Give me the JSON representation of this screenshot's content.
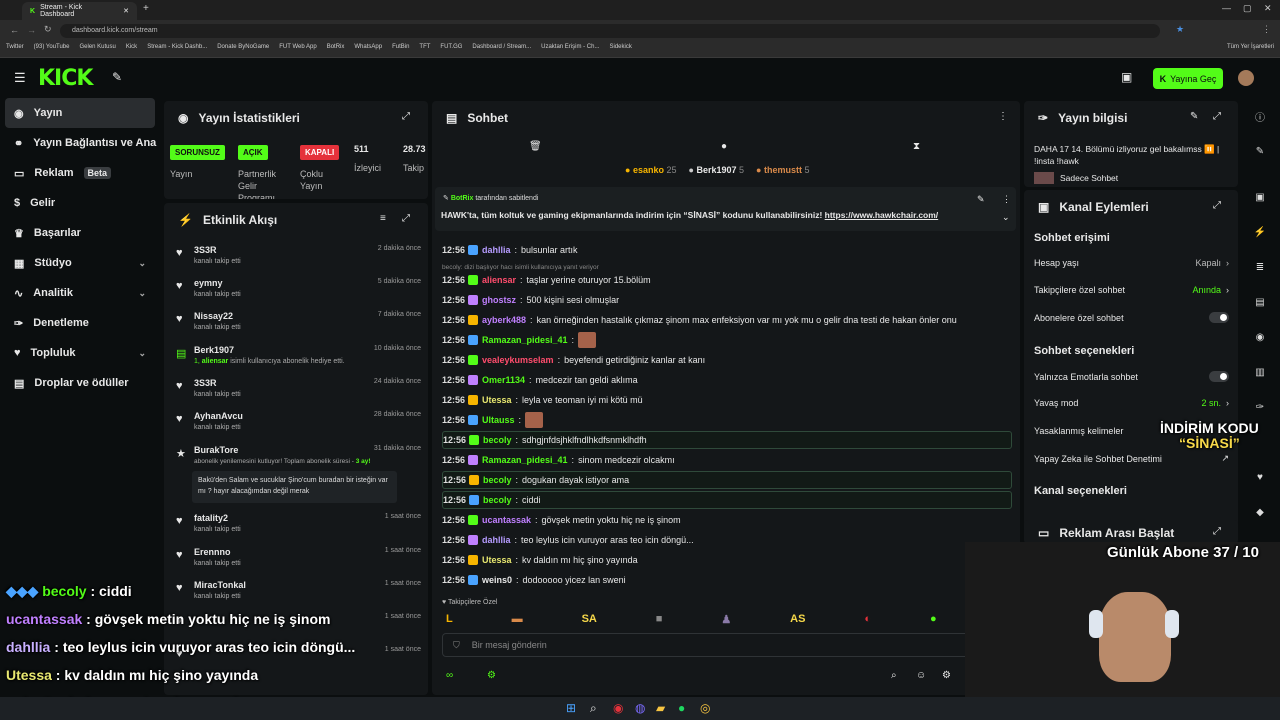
{
  "browser": {
    "tabs": [
      {
        "label": "Stream - Kick Dashboard",
        "active": true
      }
    ],
    "url": "dashboard.kick.com/stream",
    "bookmarks": [
      "Twitter",
      "(93) YouTube",
      "Gelen Kutusu",
      "Kick",
      "Stream - Kick Dashb...",
      "Donate ByNoGame",
      "FUT Web App",
      "BotRix",
      "WhatsApp",
      "FutBin",
      "TFT",
      "FUT.GG",
      "Dashboard / Stream...",
      "Uzaktan Erişim - Ch...",
      "Sidekick"
    ],
    "all_bookmarks": "Tüm Yer İşaretleri"
  },
  "header": {
    "logo": "KICK",
    "go_live": "Yayına Geç"
  },
  "sidebar": {
    "items": [
      {
        "label": "Yayın",
        "icon": "radio-icon",
        "active": true
      },
      {
        "label": "Yayın Bağlantısı ve Anahtarı",
        "icon": "link-icon"
      },
      {
        "label": "Reklam",
        "icon": "ad-icon",
        "badge": "Beta"
      },
      {
        "label": "Gelir",
        "icon": "dollar-icon"
      },
      {
        "label": "Başarılar",
        "icon": "trophy-icon"
      },
      {
        "label": "Stüdyo",
        "icon": "studio-icon",
        "expandable": true
      },
      {
        "label": "Analitik",
        "icon": "chart-icon",
        "expandable": true
      },
      {
        "label": "Denetleme",
        "icon": "wrench-icon"
      },
      {
        "label": "Topluluk",
        "icon": "community-icon",
        "expandable": true
      },
      {
        "label": "Droplar ve ödüller",
        "icon": "gift-icon"
      }
    ]
  },
  "stats": {
    "title": "Yayın İstatistikleri",
    "badges": [
      {
        "label": "SORUNSUZ",
        "caption": "Yayın",
        "color": "#53fc18"
      },
      {
        "label": "AÇIK",
        "caption": "Partnerlik Gelir Programı",
        "color": "#53fc18"
      },
      {
        "label": "KAPALI",
        "caption": "Çoklu Yayın",
        "color": "#e5323b"
      }
    ],
    "viewers": "511",
    "viewers_label": "İzleyici",
    "followers": "28.73",
    "followers_label": "Takip"
  },
  "events": {
    "title": "Etkinlik Akışı",
    "items": [
      {
        "name": "3S3R",
        "sub": "kanalı takip etti",
        "time": "2 dakika önce",
        "type": "follow"
      },
      {
        "name": "eymny",
        "sub": "kanalı takip etti",
        "time": "5 dakika önce",
        "type": "follow"
      },
      {
        "name": "Nissay22",
        "sub": "kanalı takip etti",
        "time": "7 dakika önce",
        "type": "follow"
      },
      {
        "name": "Berk1907",
        "sub_count": "1,",
        "sub_user": "aliensar",
        "sub": "isimli kullanıcıya abonelik hediye etti.",
        "time": "10 dakika önce",
        "type": "gift"
      },
      {
        "name": "3S3R",
        "sub": "kanalı takip etti",
        "time": "24 dakika önce",
        "type": "follow"
      },
      {
        "name": "AyhanAvcu",
        "sub": "kanalı takip etti",
        "time": "28 dakika önce",
        "type": "follow"
      },
      {
        "name": "BurakTore",
        "sub": "abonelik yenilemesini kutluyor! Toplam abonelik süresi -",
        "sub_months": "3 ay!",
        "time": "31 dakika önce",
        "type": "resub",
        "message": "Bakü'den Salam ve sucuklar Şino'cum buradan bir isteğin var mı ? hayır alacağımdan değil merak"
      },
      {
        "name": "fatality2",
        "sub": "kanalı takip etti",
        "time": "1 saat önce",
        "type": "follow"
      },
      {
        "name": "Erennno",
        "sub": "kanalı takip etti",
        "time": "1 saat önce",
        "type": "follow"
      },
      {
        "name": "MiracTonkal",
        "sub": "kanalı takip etti",
        "time": "1 saat önce",
        "type": "follow"
      },
      {
        "name": "",
        "sub": "",
        "time": "1 saat önce",
        "type": "follow"
      },
      {
        "name": "",
        "sub": "",
        "time": "1 saat önce",
        "type": "follow"
      }
    ]
  },
  "chat": {
    "title": "Sohbet",
    "top_gifters": [
      {
        "name": "esanko",
        "count": "25"
      },
      {
        "name": "Berk1907",
        "count": "5"
      },
      {
        "name": "themustt",
        "count": "5"
      }
    ],
    "pinned_by_user": "BotRix",
    "pinned_by_suffix": "tarafından sabitlendi",
    "pinned_text": "HAWK'ta, tüm koltuk ve gaming ekipmanlarında indirim için “SİNASİ” kodunu kullanabilirsiniz!",
    "pinned_link": "https://www.hawkchair.com/",
    "reply_context": "becoly: dizi başlıyor hacı isimli kullanıcıya yanıt veriyor",
    "messages": [
      {
        "time": "12:56",
        "user": "dahllia",
        "color": "#b69cff",
        "text": "bulsunlar artık"
      },
      {
        "time": "12:56",
        "user": "aliensar",
        "color": "#ff4d6d",
        "text": "taşlar yerine oturuyor 15.bölüm"
      },
      {
        "time": "12:56",
        "user": "ghostsz",
        "color": "#c080ff",
        "text": "500 kişini sesi olmuşlar"
      },
      {
        "time": "12:56",
        "user": "ayberk488",
        "color": "#c080ff",
        "text": "kan örneğinden hastalık çıkmaz şinom max enfeksiyon var mı yok mu o gelir dna testi de hakan önler onu"
      },
      {
        "time": "12:56",
        "user": "Ramazan_pidesi_41",
        "color": "#53fc18",
        "text": ""
      },
      {
        "time": "12:56",
        "user": "vealeykumselam",
        "color": "#ff4d6d",
        "text": "beyefendi getirdiğiniz kanlar at kanı"
      },
      {
        "time": "12:56",
        "user": "Omer1134",
        "color": "#53fc18",
        "text": "medcezir tan geldi aklıma"
      },
      {
        "time": "12:56",
        "user": "Utessa",
        "color": "#e8e870",
        "text": "leyla ve teoman iyi mi kötü mü"
      },
      {
        "time": "12:56",
        "user": "Ultauss",
        "color": "#53fc18",
        "text": ""
      },
      {
        "time": "12:56",
        "user": "becoly",
        "color": "#53fc18",
        "text": "sdhgjnfdsjhklfndlhkdfsnmklhdfh",
        "highlight": true
      },
      {
        "time": "12:56",
        "user": "Ramazan_pidesi_41",
        "color": "#53fc18",
        "text": "sinom medcezir olcakmı"
      },
      {
        "time": "12:56",
        "user": "becoly",
        "color": "#53fc18",
        "text": "dogukan dayak istiyor ama",
        "highlight": true
      },
      {
        "time": "12:56",
        "user": "becoly",
        "color": "#53fc18",
        "text": "ciddi",
        "highlight": true
      },
      {
        "time": "12:56",
        "user": "ucantassak",
        "color": "#c080ff",
        "text": "gövşek metin yoktu hiç ne iş şinom"
      },
      {
        "time": "12:56",
        "user": "dahllia",
        "color": "#b69cff",
        "text": "teo leylus icin vuruyor aras teo icin döngü..."
      },
      {
        "time": "12:56",
        "user": "Utessa",
        "color": "#e8e870",
        "text": "kv daldın mı hiç şino yayında"
      },
      {
        "time": "12:56",
        "user": "weins0",
        "color": "#e8e8e8",
        "text": "dodooooo yicez lan sweni"
      }
    ],
    "followers_only": "Takipçilere Özel",
    "emotes": [
      "L",
      "SA",
      "AS"
    ],
    "input_placeholder": "Bir mesaj gönderin"
  },
  "stream_info": {
    "title": "Yayın bilgisi",
    "text": "DAHA 17 14. Bölümü izliyoruz gel bakalımss ⏸️ | !insta !hawk",
    "sub_only": "Sadece Sohbet"
  },
  "channel_actions": {
    "title": "Kanal Eylemleri",
    "chat_access": "Sohbet erişimi",
    "rows1": [
      {
        "label": "Hesap yaşı",
        "value": "Kapalı",
        "value_color": "#bbb"
      },
      {
        "label": "Takipçilere özel sohbet",
        "value": "Anında",
        "value_color": "#53fc18"
      },
      {
        "label": "Abonelere özel sohbet",
        "toggle": true
      }
    ],
    "chat_options": "Sohbet seçenekleri",
    "rows2": [
      {
        "label": "Yalnızca Emotlarla sohbet",
        "toggle": true
      },
      {
        "label": "Yavaş mod",
        "value": "2 sn.",
        "value_color": "#53fc18"
      },
      {
        "label": "Yasaklanmış kelimeler"
      },
      {
        "label": "Yapay Zeka ile Sohbet Denetimi"
      }
    ],
    "channel_options": "Kanal seçenekleri",
    "ad_break": "Reklam Arası Başlat"
  },
  "overlay": {
    "promo_line1": "İNDİRİM KODU",
    "promo_line2": "“SİNASİ”",
    "daily_subs": "Günlük Abone 37 / 10",
    "chat_lines": [
      {
        "user": "becoly",
        "text": "ciddi",
        "color": "#53fc18"
      },
      {
        "user": "ucantassak",
        "text": "gövşek metin yoktu hiç ne iş şinom",
        "color": "#c080ff"
      },
      {
        "user": "dahllia",
        "text": "teo leylus icin vuruyor aras teo icin döngü...",
        "color": "#c8b0ff"
      },
      {
        "user": "Utessa",
        "text": "kv daldın mı hiç şino yayında",
        "color": "#e8e870"
      },
      {
        "user": "weins0",
        "text": "dodooooo yicez lan sweni",
        "color": "#ffffff"
      }
    ]
  }
}
